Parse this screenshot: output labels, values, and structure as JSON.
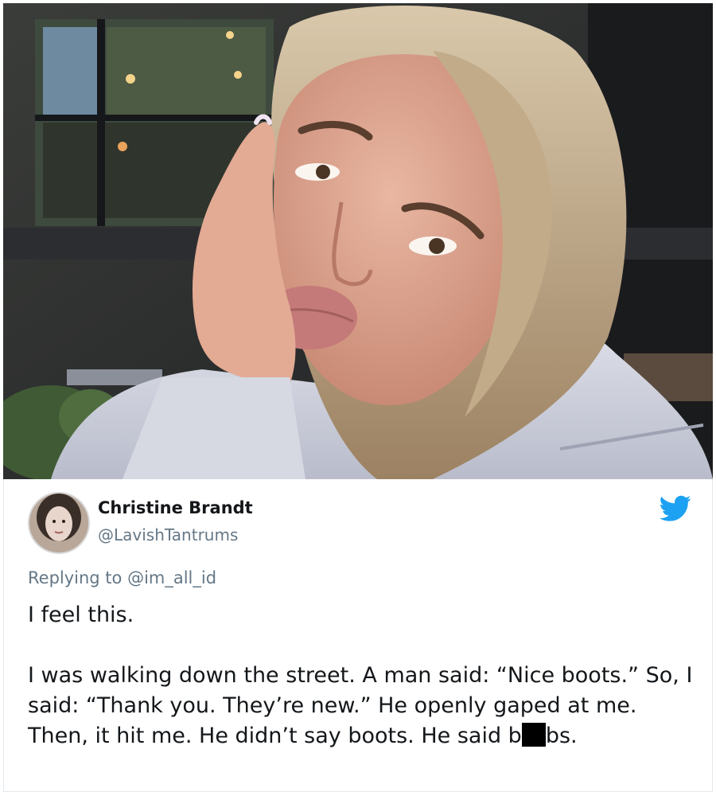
{
  "tweet": {
    "author_name": "Christine Brandt",
    "author_handle": "@LavishTantrums",
    "replying_to": "Replying to @im_all_id",
    "text_line1": "I feel this.",
    "text_para2_part1": "I was walking down the street. A man said: “Nice boots.” So, I said: “Thank you. They’re new.” He openly gaped at me. Then, it hit me. He didn’t say boots. He said b",
    "text_para2_part2": "bs."
  },
  "icons": {
    "brand": "twitter-bird-icon",
    "avatar": "profile-avatar"
  },
  "colors": {
    "twitter_blue": "#1da1f2",
    "muted_text": "#657786",
    "primary_text": "#14171a"
  }
}
